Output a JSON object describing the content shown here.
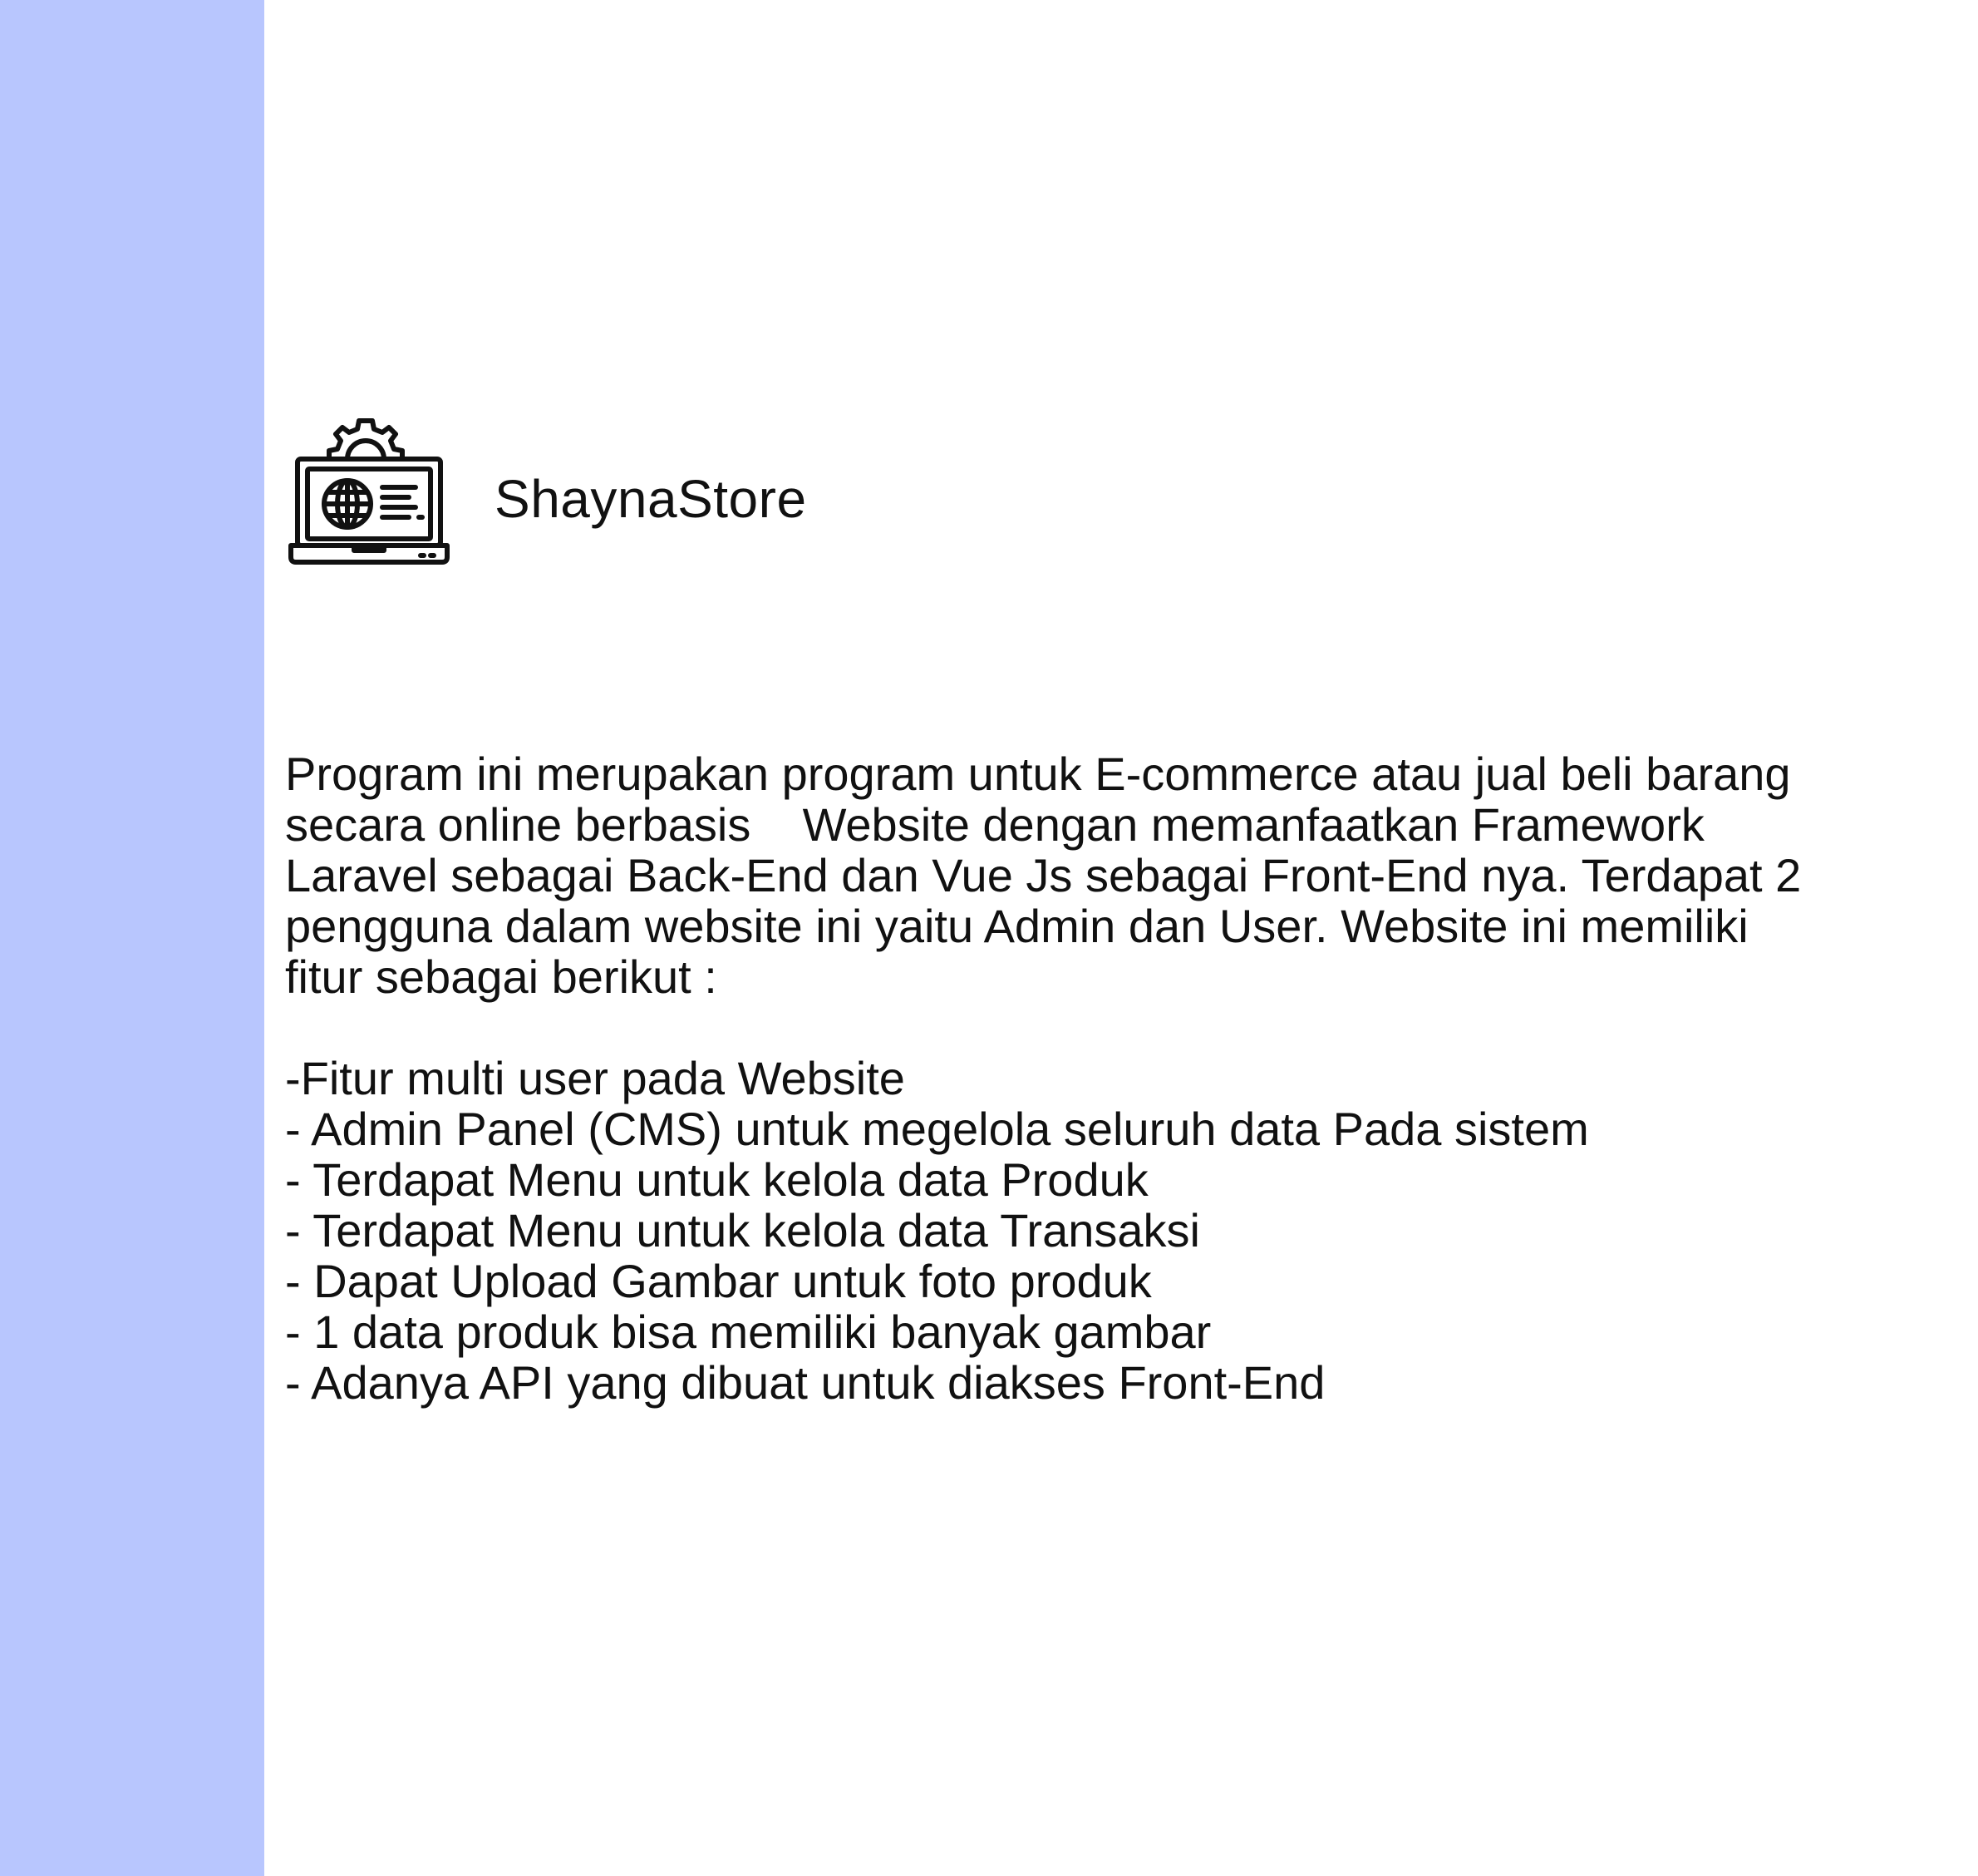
{
  "brand": {
    "name": "ShaynaStore",
    "icon": "laptop-web-settings-icon"
  },
  "colors": {
    "side_strip": "#b8c6fe",
    "background": "#ffffff",
    "text": "#111111"
  },
  "description": {
    "lines": [
      "Program ini merupakan program untuk E-commerce atau jual beli barang",
      "secara online berbasis    Website dengan memanfaatkan Framework",
      "Laravel sebagai Back-End dan Vue Js sebagai Front-End nya. Terdapat 2",
      "pengguna dalam website ini yaitu Admin dan User. Website ini memiliki",
      "fitur sebagai berikut :"
    ]
  },
  "features": [
    "-Fitur multi user pada Website",
    "- Admin Panel (CMS) untuk megelola seluruh data Pada sistem",
    "- Terdapat Menu untuk kelola data Produk",
    "- Terdapat Menu untuk kelola data Transaksi",
    "- Dapat Upload Gambar untuk foto produk",
    "- 1 data produk bisa memiliki banyak gambar",
    "- Adanya API yang dibuat untuk diakses Front-End"
  ]
}
